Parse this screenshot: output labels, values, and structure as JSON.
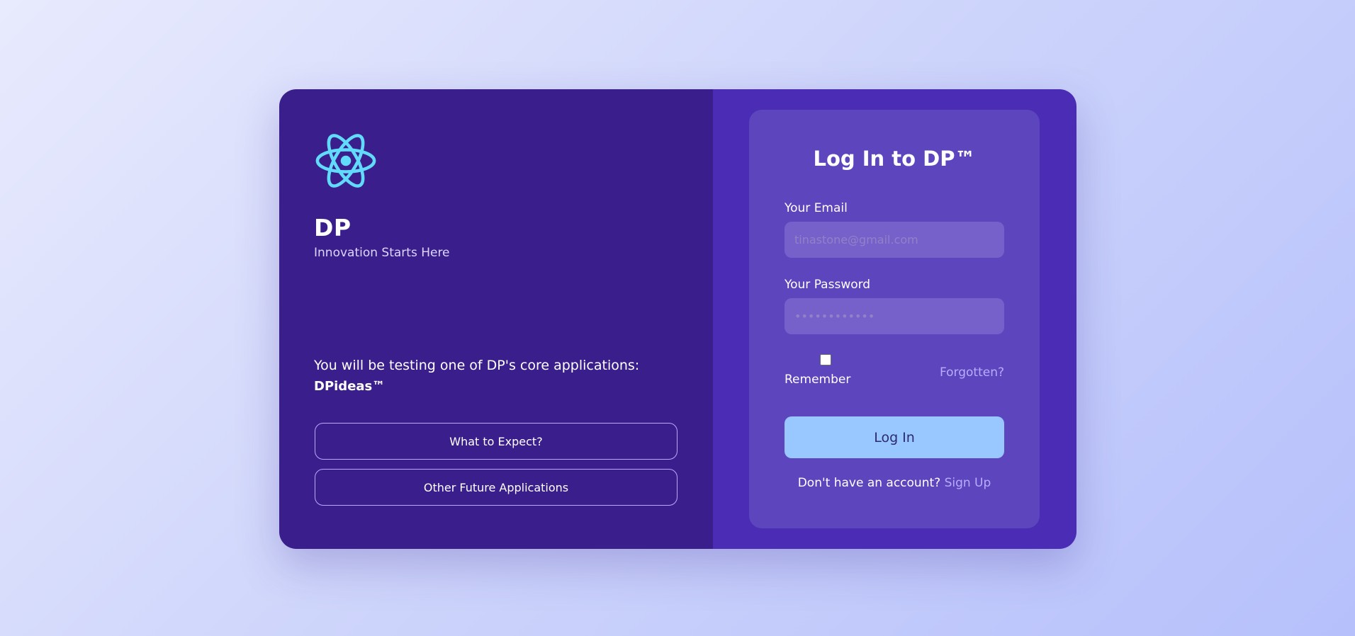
{
  "brand": {
    "name": "DP",
    "tagline": "Innovation Starts Here",
    "logo_icon": "atom-icon",
    "logo_color": "#61dafb"
  },
  "intro": {
    "text": "You will be testing one of DP's core applications:",
    "app_name": "DPideas™"
  },
  "buttons": {
    "what_to_expect": "What to Expect?",
    "other_apps": "Other Future Applications"
  },
  "login": {
    "title": "Log In to DP™",
    "email_label": "Your Email",
    "email_placeholder": "tinastone@gmail.com",
    "password_label": "Your Password",
    "password_placeholder": "••••••••••••",
    "remember_label": "Remember",
    "remember_checked": false,
    "forgot_link": "Forgotten?",
    "submit_label": "Log In",
    "signup_prompt": "Don't have an account?",
    "signup_link": "Sign Up"
  },
  "colors": {
    "left_panel": "#3a1f8c",
    "right_panel": "#4b2db5",
    "form_card": "#5c45bd",
    "submit_button": "#99c7ff",
    "link": "#b8adff"
  }
}
